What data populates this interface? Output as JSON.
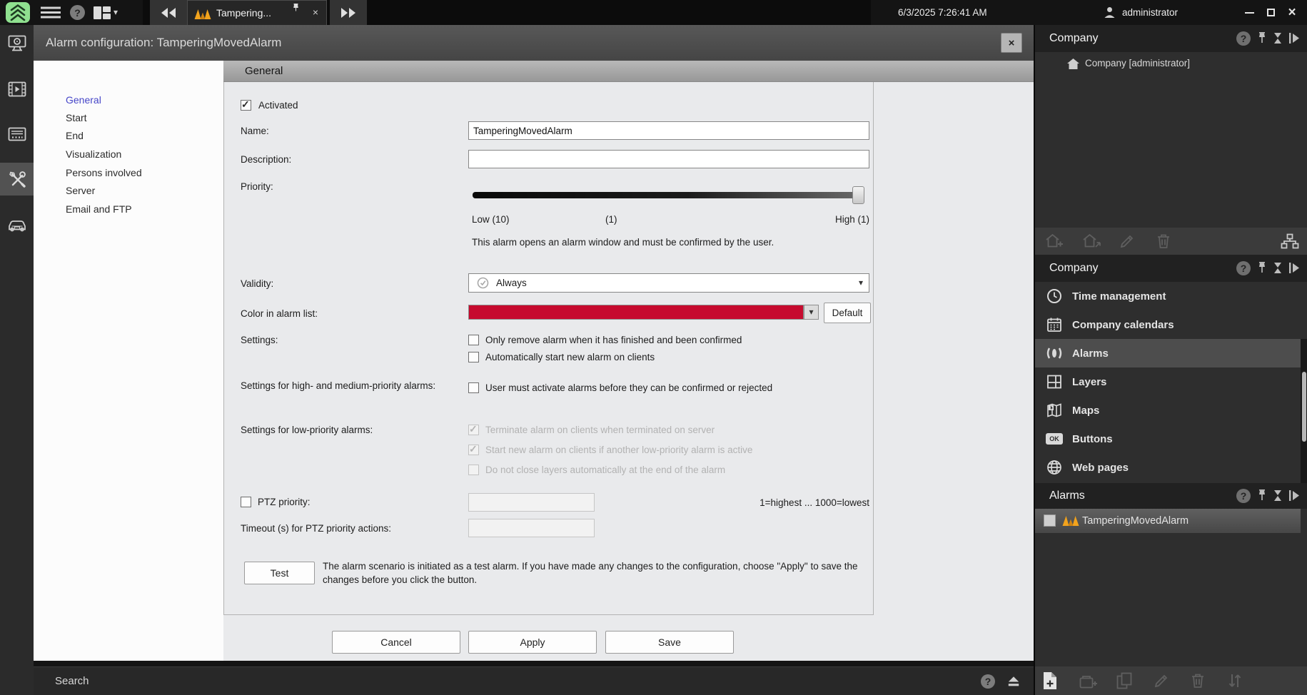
{
  "colors": {
    "alarm_red": "#c60a2e",
    "selected_nav_blue": "#4646c8",
    "tab_icon_orange": "#f2a31d"
  },
  "icons": {
    "help": "?",
    "close": "×",
    "caret_down": "▾",
    "ok": "OK"
  },
  "topbar": {
    "tab_label": "Tampering...",
    "datetime": "6/3/2025 7:26:41 AM",
    "user": "administrator"
  },
  "dialog": {
    "title": "Alarm configuration: TamperingMovedAlarm",
    "section_header": "General",
    "nav": [
      {
        "label": "General",
        "selected": true
      },
      {
        "label": "Start",
        "selected": false
      },
      {
        "label": "End",
        "selected": false
      },
      {
        "label": "Visualization",
        "selected": false
      },
      {
        "label": "Persons involved",
        "selected": false
      },
      {
        "label": "Server",
        "selected": false
      },
      {
        "label": "Email and FTP",
        "selected": false
      }
    ],
    "form": {
      "activated": {
        "label": "Activated",
        "checked": true
      },
      "name": {
        "label": "Name:",
        "value": "TamperingMovedAlarm"
      },
      "description": {
        "label": "Description:",
        "value": ""
      },
      "priority": {
        "label": "Priority:",
        "low": "Low (10)",
        "mid": "(1)",
        "high": "High (1)",
        "note": "This alarm opens an alarm window and must be confirmed by the user."
      },
      "validity": {
        "label": "Validity:",
        "value": "Always"
      },
      "color": {
        "label": "Color in alarm list:",
        "value": "#c60a2e",
        "default_button": "Default"
      },
      "settings": {
        "label": "Settings:",
        "options": [
          {
            "label": "Only remove alarm when it has finished and been confirmed",
            "checked": false
          },
          {
            "label": "Automatically start new alarm on clients",
            "checked": false
          }
        ]
      },
      "high_priority": {
        "label": "Settings for high- and medium-priority alarms:",
        "options": [
          {
            "label": "User must activate alarms before they can be confirmed or rejected",
            "checked": false
          }
        ]
      },
      "low_priority": {
        "label": "Settings for low-priority alarms:",
        "options": [
          {
            "label": "Terminate alarm on clients when terminated on server",
            "checked": true,
            "disabled": true
          },
          {
            "label": "Start new alarm on clients if another low-priority alarm is active",
            "checked": true,
            "disabled": true
          },
          {
            "label": "Do not close layers automatically at the end of the alarm",
            "checked": false,
            "disabled": true
          }
        ]
      },
      "ptz": {
        "label": "PTZ priority:",
        "checked": false,
        "value": "",
        "hint": "1=highest ... 1000=lowest"
      },
      "timeout": {
        "label": "Timeout (s) for PTZ priority actions:",
        "value": ""
      },
      "test": {
        "button": "Test",
        "note": "The alarm scenario is initiated as a test alarm. If you have made any changes to the configuration, choose \"Apply\" to save the changes before you click the button."
      }
    },
    "buttons": {
      "cancel": "Cancel",
      "apply": "Apply",
      "save": "Save"
    }
  },
  "search": {
    "label": "Search"
  },
  "right_panel": {
    "sections": [
      {
        "title": "Company",
        "root": "Company [administrator]"
      },
      {
        "title": "Company",
        "items": [
          {
            "label": "Time management",
            "selected": false
          },
          {
            "label": "Company calendars",
            "selected": false
          },
          {
            "label": "Alarms",
            "selected": true
          },
          {
            "label": "Layers",
            "selected": false
          },
          {
            "label": "Maps",
            "selected": false
          },
          {
            "label": "Buttons",
            "selected": false,
            "icon_text": "OK"
          },
          {
            "label": "Web pages",
            "selected": false
          }
        ]
      },
      {
        "title": "Alarms",
        "items": [
          {
            "label": "TamperingMovedAlarm",
            "selected": true,
            "checked": false
          }
        ]
      }
    ]
  }
}
